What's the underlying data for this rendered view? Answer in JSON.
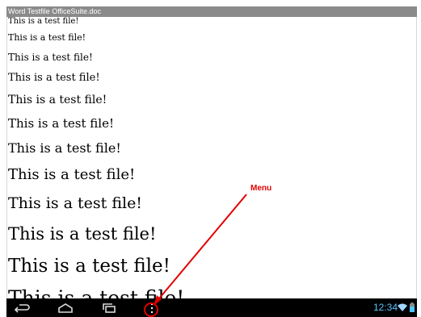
{
  "window": {
    "title": "Word Testfile OfficeSuite.doc"
  },
  "document": {
    "lines": [
      {
        "text": "This is a test file!",
        "size": 10
      },
      {
        "text": "This is a test file!",
        "size": 11
      },
      {
        "text": "This is a test file!",
        "size": 12
      },
      {
        "text": "This is a test file!",
        "size": 13
      },
      {
        "text": "This is a test file!",
        "size": 14
      },
      {
        "text": "This is a test file!",
        "size": 15
      },
      {
        "text": "This is a test file!",
        "size": 16
      },
      {
        "text": "This is a test file!",
        "size": 18
      },
      {
        "text": "This is a test file!",
        "size": 19
      },
      {
        "text": "This is a test file!",
        "size": 21
      },
      {
        "text": "This is a test file!",
        "size": 23
      },
      {
        "text": "This is a test file!",
        "size": 25
      }
    ]
  },
  "navbar": {
    "buttons": [
      "back",
      "home",
      "recent-apps",
      "menu"
    ],
    "clock": "12:34"
  },
  "annotation": {
    "label": "Menu",
    "color": "#e30000"
  },
  "colors": {
    "navbar": "#000000",
    "titlebar": "#8a8a8a",
    "clock": "#57c3ff"
  }
}
